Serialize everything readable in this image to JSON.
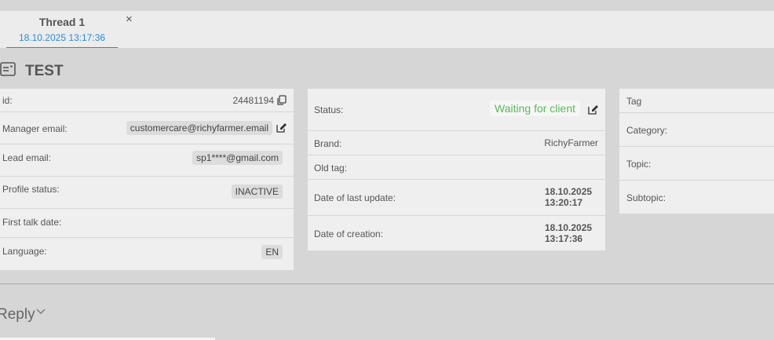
{
  "tab": {
    "title": "Thread 1",
    "date": "18.10.2025 13:17:36",
    "close_glyph": "×"
  },
  "ticket": {
    "title": "TEST",
    "icon": "ticket-icon"
  },
  "client_panel": {
    "id_label": "id:",
    "id_value": "24481194",
    "manager_email_label": "Manager email:",
    "manager_email_value": "customercare@richyfarmer.email",
    "lead_email_label": "Lead email:",
    "lead_email_value": "sp1****@gmail.com",
    "profile_status_label": "Profile status:",
    "profile_status_value": "INACTIVE",
    "first_talk_label": "First talk date:",
    "first_talk_value": "",
    "language_label": "Language:",
    "language_value": "EN"
  },
  "status_panel": {
    "status_label": "Status:",
    "status_value": "Waiting for client",
    "status_color": "#5cb85c",
    "brand_label": "Brand:",
    "brand_value": "RichyFarmer",
    "old_tag_label": "Old tag:",
    "old_tag_value": "",
    "last_update_label": "Date of last update:",
    "last_update_date": "18.10.2025",
    "last_update_time": "13:20:17",
    "creation_label": "Date of creation:",
    "creation_date": "18.10.2025",
    "creation_time": "13:17:36"
  },
  "tag_panel": {
    "tag_label": "Tag",
    "category_label": "Category:",
    "topic_label": "Topic:",
    "subtopic_label": "Subtopic:"
  },
  "reply": {
    "label": "Reply"
  },
  "colors": {
    "accent": "#2b8bd9",
    "background": "#d6d6d6",
    "panel": "#efefef"
  }
}
